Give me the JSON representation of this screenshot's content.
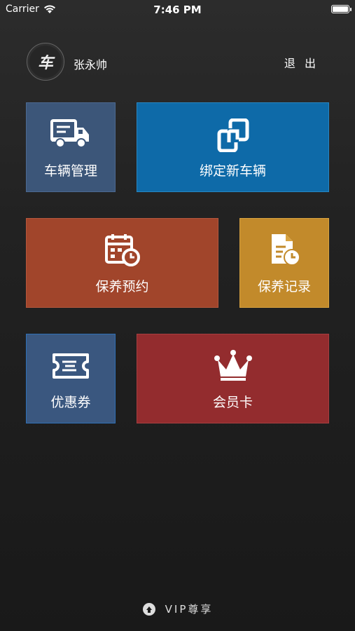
{
  "status_bar": {
    "carrier": "Carrier",
    "time": "7:46 PM",
    "battery_level": 1.0
  },
  "header": {
    "avatar_glyph": "车",
    "username": "张永帅",
    "logout_label": "退 出"
  },
  "tiles": [
    {
      "label": "车辆管理",
      "icon": "truck-icon",
      "color": "#3c5679"
    },
    {
      "label": "绑定新车辆",
      "icon": "link-icon",
      "color": "#0e6aa8"
    },
    {
      "label": "保养预约",
      "icon": "calendar-clock-icon",
      "color": "#a1452b"
    },
    {
      "label": "保养记录",
      "icon": "document-clock-icon",
      "color": "#c28a2b"
    },
    {
      "label": "优惠券",
      "icon": "ticket-icon",
      "color": "#3a577f"
    },
    {
      "label": "会员卡",
      "icon": "crown-icon",
      "color": "#932c2e"
    }
  ],
  "footer": {
    "brand_text": "VIP尊享"
  }
}
